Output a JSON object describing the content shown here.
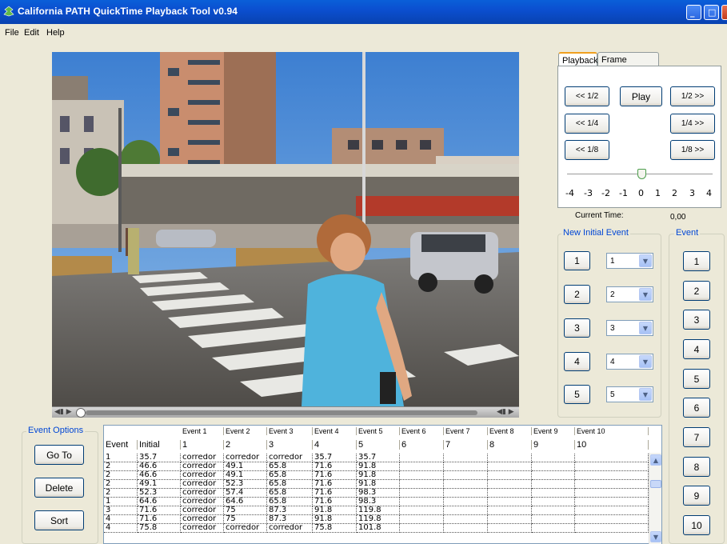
{
  "window": {
    "title": "California PATH QuickTime Playback Tool v0.94",
    "minimize_glyph": "_",
    "maximize_glyph": "□"
  },
  "menu": [
    "File",
    "Edit",
    "Help"
  ],
  "video_controls": {
    "left_glyph": "◀▮ ▶",
    "right_glyph": "◀▮ ▶"
  },
  "playback": {
    "tabs": [
      "Playback",
      "Frame Advance"
    ],
    "active_tab": "Playback",
    "buttons": {
      "back_half": "<< 1/2",
      "play": "Play",
      "fwd_half": "1/2 >>",
      "back_quarter": "<< 1/4",
      "fwd_quarter": "1/4 >>",
      "back_eighth": "<< 1/8",
      "fwd_eighth": "1/8 >>"
    },
    "speed_ticks": [
      "-4",
      "-3",
      "-2",
      "-1",
      "0",
      "1",
      "2",
      "3",
      "4"
    ],
    "speed_value": 0.5
  },
  "current_time": {
    "label": "Current Time:",
    "value": "0,00"
  },
  "new_initial_event": {
    "title": "New Initial Event",
    "rows": [
      {
        "button": "1",
        "select": "1"
      },
      {
        "button": "2",
        "select": "2"
      },
      {
        "button": "3",
        "select": "3"
      },
      {
        "button": "4",
        "select": "4"
      },
      {
        "button": "5",
        "select": "5"
      }
    ]
  },
  "event_panel": {
    "title": "Event",
    "buttons": [
      "1",
      "2",
      "3",
      "4",
      "5",
      "6",
      "7",
      "8",
      "9",
      "10"
    ]
  },
  "event_options": {
    "title": "Event Options",
    "buttons": {
      "goto": "Go To",
      "delete": "Delete",
      "sort": "Sort"
    }
  },
  "table": {
    "group_headers": [
      "",
      "",
      "Event 1",
      "Event 2",
      "Event 3",
      "Event 4",
      "Event 5",
      "Event 6",
      "Event 7",
      "Event 8",
      "Event 9",
      "Event 10"
    ],
    "columns": [
      "Event",
      "Initial",
      "1",
      "2",
      "3",
      "4",
      "5",
      "6",
      "7",
      "8",
      "9",
      "10"
    ],
    "rows": [
      [
        "1",
        "35.7",
        "corredor",
        "corredor",
        "corredor",
        "35.7",
        "35.7",
        "",
        "",
        "",
        "",
        ""
      ],
      [
        "2",
        "46.6",
        "corredor",
        "49.1",
        "65.8",
        "71.6",
        "91.8",
        "",
        "",
        "",
        "",
        ""
      ],
      [
        "2",
        "46.6",
        "corredor",
        "49.1",
        "65.8",
        "71.6",
        "91.8",
        "",
        "",
        "",
        "",
        ""
      ],
      [
        "2",
        "49.1",
        "corredor",
        "52.3",
        "65.8",
        "71.6",
        "91.8",
        "",
        "",
        "",
        "",
        ""
      ],
      [
        "2",
        "52.3",
        "corredor",
        "57.4",
        "65.8",
        "71.6",
        "98.3",
        "",
        "",
        "",
        "",
        ""
      ],
      [
        "1",
        "64.6",
        "corredor",
        "64.6",
        "65.8",
        "71.6",
        "98.3",
        "",
        "",
        "",
        "",
        ""
      ],
      [
        "3",
        "71.6",
        "corredor",
        "75",
        "87.3",
        "91.8",
        "119.8",
        "",
        "",
        "",
        "",
        ""
      ],
      [
        "4",
        "71.6",
        "corredor",
        "75",
        "87.3",
        "91.8",
        "119.8",
        "",
        "",
        "",
        "",
        ""
      ],
      [
        "4",
        "75.8",
        "corredor",
        "corredor",
        "corredor",
        "75.8",
        "101.8",
        "",
        "",
        "",
        "",
        ""
      ]
    ]
  }
}
